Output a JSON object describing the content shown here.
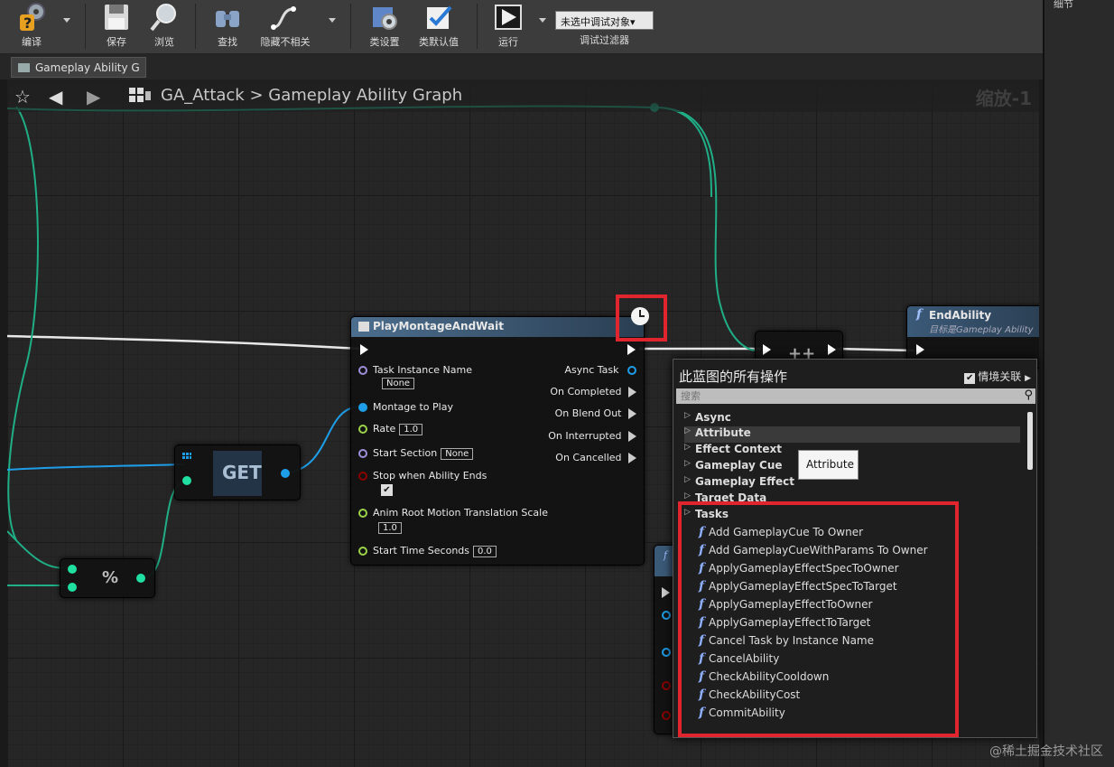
{
  "toolbar": {
    "compile": "编译",
    "save": "保存",
    "browse": "浏览",
    "find": "查找",
    "hide_unrelated": "隐藏不相关",
    "class_settings": "类设置",
    "class_defaults": "类默认值",
    "run": "运行",
    "debug_object": "未选中调试对象▾",
    "debug_filter": "调试过滤器"
  },
  "right_panel": {
    "details": "细节"
  },
  "tab": {
    "label": "Gameplay Ability G"
  },
  "graph_header": {
    "breadcrumb_asset": "GA_Attack",
    "breadcrumb_sep": ">",
    "breadcrumb_graph": "Gameplay Ability Graph",
    "zoom": "缩放-1"
  },
  "nodes": {
    "play_montage": {
      "title": "PlayMontageAndWait",
      "inputs": {
        "task_instance_name": "Task Instance Name",
        "task_instance_value": "None",
        "montage": "Montage to Play",
        "rate": "Rate",
        "rate_value": "1.0",
        "start_section": "Start Section",
        "start_section_value": "None",
        "stop_when_ends": "Stop when Ability Ends",
        "stop_when_ends_check": "✔",
        "anim_root_motion": "Anim Root Motion Translation Scale",
        "anim_root_motion_value": "1.0",
        "start_time": "Start Time Seconds",
        "start_time_value": "0.0"
      },
      "outputs": {
        "async_task": "Async Task",
        "on_completed": "On Completed",
        "on_blend_out": "On Blend Out",
        "on_interrupted": "On Interrupted",
        "on_cancelled": "On Cancelled"
      }
    },
    "get": {
      "title": "GET"
    },
    "modulo": {
      "title": "%"
    },
    "increment": {
      "title": "++"
    },
    "end_ability": {
      "title": "EndAbility",
      "subtitle": "目标是Gameplay Ability"
    },
    "partial_node": {
      "glyph": "f"
    }
  },
  "action_menu": {
    "title": "此蓝图的所有操作",
    "context_sensitive": "情境关联",
    "context_check": "✔",
    "search_placeholder": "搜索",
    "categories": [
      "Async",
      "Attribute",
      "Effect Context",
      "Gameplay Cue",
      "Gameplay Effect",
      "Target Data",
      "Tasks"
    ],
    "items": [
      "Add GameplayCue To Owner",
      "Add GameplayCueWithParams To Owner",
      "ApplyGameplayEffectSpecToOwner",
      "ApplyGameplayEffectSpecToTarget",
      "ApplyGameplayEffectToOwner",
      "ApplyGameplayEffectToTarget",
      "Cancel Task by Instance Name",
      "CancelAbility",
      "CheckAbilityCooldown",
      "CheckAbilityCost",
      "CommitAbility"
    ],
    "function_glyph": "f"
  },
  "tooltip": {
    "text": "Attribute"
  },
  "watermark": "@稀土掘金技术社区",
  "icons": {
    "compile": "compile-icon",
    "save": "save-icon",
    "browse": "browse-icon",
    "find": "find-icon",
    "hide": "hide-unrelated-icon",
    "class_settings": "class-settings-icon",
    "class_defaults": "class-defaults-icon",
    "run": "run-icon",
    "star": "star-icon",
    "back": "back-arrow-icon",
    "forward": "forward-arrow-icon",
    "latent": "clock-icon"
  },
  "colors": {
    "accent_red": "#e1252e",
    "exec_wire": "#ffffff",
    "int_pin": "#1fe0a0",
    "object_pin": "#1e9ee8",
    "name_pin": "#9e8edb",
    "bool_pin": "#8b0000",
    "float_pin": "#9cd24a",
    "node_title_blue": "#3b5a78"
  }
}
